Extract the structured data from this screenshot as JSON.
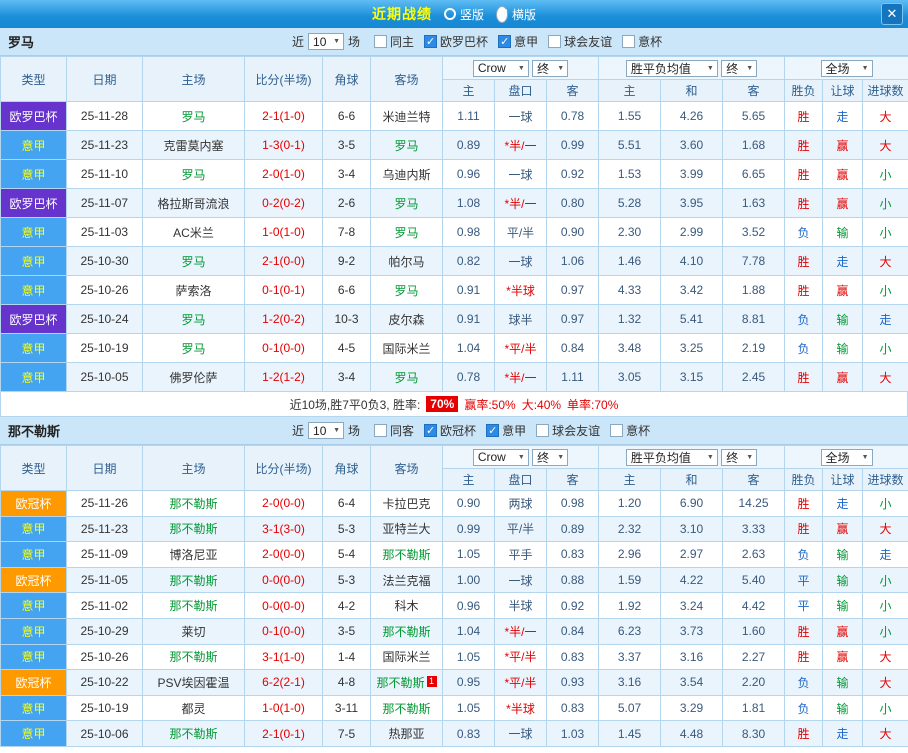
{
  "titlebar": {
    "title": "近期战绩",
    "radios": [
      {
        "label": "竖版",
        "selected": false
      },
      {
        "label": "横版",
        "selected": true
      }
    ],
    "close": "✕"
  },
  "controls": {
    "near": "近",
    "games": "10",
    "games_suffix": "场",
    "company": "Crow",
    "period1": "终",
    "avg": "胜平负均值",
    "period2": "终",
    "scope": "全场"
  },
  "columns": [
    "类型",
    "日期",
    "主场",
    "比分(半场)",
    "角球",
    "客场",
    "主",
    "盘口",
    "客",
    "主",
    "和",
    "客",
    "胜负",
    "让球",
    "进球数"
  ],
  "sections": [
    {
      "team": "罗马",
      "filters": [
        {
          "label": "同主",
          "checked": false
        },
        {
          "label": "欧罗巴杯",
          "checked": true
        },
        {
          "label": "意甲",
          "checked": true
        },
        {
          "label": "球会友谊",
          "checked": false
        },
        {
          "label": "意杯",
          "checked": false
        }
      ],
      "rows": [
        {
          "league": "欧罗巴杯",
          "league_style": "europa",
          "date": "25-11-28",
          "home": "罗马",
          "home_focus": true,
          "score": "2-1(1-0)",
          "corners": "6-6",
          "away": "米迪兰特",
          "away_focus": false,
          "odds_home": "1.11",
          "handicap": "一球",
          "odds_away": "0.78",
          "win": "1.55",
          "draw": "4.26",
          "lose": "5.65",
          "result": "胜",
          "result_color": "red",
          "hresult": "走",
          "hresult_color": "blue",
          "goals": "大",
          "goals_color": "red"
        },
        {
          "league": "意甲",
          "league_style": "seriea",
          "date": "25-11-23",
          "home": "克雷莫内塞",
          "home_focus": false,
          "score": "1-3(0-1)",
          "corners": "3-5",
          "away": "罗马",
          "away_focus": true,
          "odds_home": "0.89",
          "handicap": "*半/一",
          "odds_away": "0.99",
          "win": "5.51",
          "draw": "3.60",
          "lose": "1.68",
          "result": "胜",
          "result_color": "red",
          "hresult": "赢",
          "hresult_color": "red",
          "goals": "大",
          "goals_color": "red"
        },
        {
          "league": "意甲",
          "league_style": "seriea",
          "date": "25-11-10",
          "home": "罗马",
          "home_focus": true,
          "score": "2-0(1-0)",
          "corners": "3-4",
          "away": "乌迪内斯",
          "away_focus": false,
          "odds_home": "0.96",
          "handicap": "一球",
          "odds_away": "0.92",
          "win": "1.53",
          "draw": "3.99",
          "lose": "6.65",
          "result": "胜",
          "result_color": "red",
          "hresult": "赢",
          "hresult_color": "red",
          "goals": "小",
          "goals_color": "green"
        },
        {
          "league": "欧罗巴杯",
          "league_style": "europa",
          "date": "25-11-07",
          "home": "格拉斯哥流浪",
          "home_focus": false,
          "score": "0-2(0-2)",
          "corners": "2-6",
          "away": "罗马",
          "away_focus": true,
          "odds_home": "1.08",
          "handicap": "*半/一",
          "odds_away": "0.80",
          "win": "5.28",
          "draw": "3.95",
          "lose": "1.63",
          "result": "胜",
          "result_color": "red",
          "hresult": "赢",
          "hresult_color": "red",
          "goals": "小",
          "goals_color": "green"
        },
        {
          "league": "意甲",
          "league_style": "seriea",
          "date": "25-11-03",
          "home": "AC米兰",
          "home_focus": false,
          "score": "1-0(1-0)",
          "corners": "7-8",
          "away": "罗马",
          "away_focus": true,
          "odds_home": "0.98",
          "handicap": "平/半",
          "odds_away": "0.90",
          "win": "2.30",
          "draw": "2.99",
          "lose": "3.52",
          "result": "负",
          "result_color": "blue",
          "hresult": "输",
          "hresult_color": "green",
          "goals": "小",
          "goals_color": "green"
        },
        {
          "league": "意甲",
          "league_style": "seriea",
          "date": "25-10-30",
          "home": "罗马",
          "home_focus": true,
          "score": "2-1(0-0)",
          "corners": "9-2",
          "away": "帕尔马",
          "away_focus": false,
          "odds_home": "0.82",
          "handicap": "一球",
          "odds_away": "1.06",
          "win": "1.46",
          "draw": "4.10",
          "lose": "7.78",
          "result": "胜",
          "result_color": "red",
          "hresult": "走",
          "hresult_color": "blue",
          "goals": "大",
          "goals_color": "red"
        },
        {
          "league": "意甲",
          "league_style": "seriea",
          "date": "25-10-26",
          "home": "萨索洛",
          "home_focus": false,
          "score": "0-1(0-1)",
          "corners": "6-6",
          "away": "罗马",
          "away_focus": true,
          "odds_home": "0.91",
          "handicap": "*半球",
          "odds_away": "0.97",
          "win": "4.33",
          "draw": "3.42",
          "lose": "1.88",
          "result": "胜",
          "result_color": "red",
          "hresult": "赢",
          "hresult_color": "red",
          "goals": "小",
          "goals_color": "green"
        },
        {
          "league": "欧罗巴杯",
          "league_style": "europa",
          "date": "25-10-24",
          "home": "罗马",
          "home_focus": true,
          "score": "1-2(0-2)",
          "corners": "10-3",
          "away": "皮尔森",
          "away_focus": false,
          "odds_home": "0.91",
          "handicap": "球半",
          "odds_away": "0.97",
          "win": "1.32",
          "draw": "5.41",
          "lose": "8.81",
          "result": "负",
          "result_color": "blue",
          "hresult": "输",
          "hresult_color": "green",
          "goals": "走",
          "goals_color": "blue"
        },
        {
          "league": "意甲",
          "league_style": "seriea",
          "date": "25-10-19",
          "home": "罗马",
          "home_focus": true,
          "score": "0-1(0-0)",
          "corners": "4-5",
          "away": "国际米兰",
          "away_focus": false,
          "odds_home": "1.04",
          "handicap": "*平/半",
          "odds_away": "0.84",
          "win": "3.48",
          "draw": "3.25",
          "lose": "2.19",
          "result": "负",
          "result_color": "blue",
          "hresult": "输",
          "hresult_color": "green",
          "goals": "小",
          "goals_color": "green"
        },
        {
          "league": "意甲",
          "league_style": "seriea",
          "date": "25-10-05",
          "home": "佛罗伦萨",
          "home_focus": false,
          "score": "1-2(1-2)",
          "corners": "3-4",
          "away": "罗马",
          "away_focus": true,
          "odds_home": "0.78",
          "handicap": "*半/一",
          "odds_away": "1.11",
          "win": "3.05",
          "draw": "3.15",
          "lose": "2.45",
          "result": "胜",
          "result_color": "red",
          "hresult": "赢",
          "hresult_color": "red",
          "goals": "大",
          "goals_color": "red"
        }
      ],
      "summary": {
        "prefix": "近10场,胜7平0负3, 胜率:",
        "rate": "70%",
        "part1": "赢率:50%",
        "part2": "大:40%",
        "part3": "单率:70%"
      }
    },
    {
      "team": "那不勒斯",
      "filters": [
        {
          "label": "同客",
          "checked": false
        },
        {
          "label": "欧冠杯",
          "checked": true
        },
        {
          "label": "意甲",
          "checked": true
        },
        {
          "label": "球会友谊",
          "checked": false
        },
        {
          "label": "意杯",
          "checked": false
        }
      ],
      "rows": [
        {
          "league": "欧冠杯",
          "league_style": "ucl",
          "date": "25-11-26",
          "home": "那不勒斯",
          "home_focus": true,
          "score": "2-0(0-0)",
          "corners": "6-4",
          "away": "卡拉巴克",
          "away_focus": false,
          "odds_home": "0.90",
          "handicap": "两球",
          "odds_away": "0.98",
          "win": "1.20",
          "draw": "6.90",
          "lose": "14.25",
          "result": "胜",
          "result_color": "red",
          "hresult": "走",
          "hresult_color": "blue",
          "goals": "小",
          "goals_color": "green"
        },
        {
          "league": "意甲",
          "league_style": "seriea",
          "date": "25-11-23",
          "home": "那不勒斯",
          "home_focus": true,
          "score": "3-1(3-0)",
          "corners": "5-3",
          "away": "亚特兰大",
          "away_focus": false,
          "odds_home": "0.99",
          "handicap": "平/半",
          "odds_away": "0.89",
          "win": "2.32",
          "draw": "3.10",
          "lose": "3.33",
          "result": "胜",
          "result_color": "red",
          "hresult": "赢",
          "hresult_color": "red",
          "goals": "大",
          "goals_color": "red"
        },
        {
          "league": "意甲",
          "league_style": "seriea",
          "date": "25-11-09",
          "home": "博洛尼亚",
          "home_focus": false,
          "score": "2-0(0-0)",
          "corners": "5-4",
          "away": "那不勒斯",
          "away_focus": true,
          "odds_home": "1.05",
          "handicap": "平手",
          "odds_away": "0.83",
          "win": "2.96",
          "draw": "2.97",
          "lose": "2.63",
          "result": "负",
          "result_color": "blue",
          "hresult": "输",
          "hresult_color": "green",
          "goals": "走",
          "goals_color": "blue"
        },
        {
          "league": "欧冠杯",
          "league_style": "ucl",
          "date": "25-11-05",
          "home": "那不勒斯",
          "home_focus": true,
          "score": "0-0(0-0)",
          "corners": "5-3",
          "away": "法兰克福",
          "away_focus": false,
          "odds_home": "1.00",
          "handicap": "一球",
          "odds_away": "0.88",
          "win": "1.59",
          "draw": "4.22",
          "lose": "5.40",
          "result": "平",
          "result_color": "blue",
          "hresult": "输",
          "hresult_color": "green",
          "goals": "小",
          "goals_color": "green"
        },
        {
          "league": "意甲",
          "league_style": "seriea",
          "date": "25-11-02",
          "home": "那不勒斯",
          "home_focus": true,
          "score": "0-0(0-0)",
          "corners": "4-2",
          "away": "科木",
          "away_focus": false,
          "odds_home": "0.96",
          "handicap": "半球",
          "odds_away": "0.92",
          "win": "1.92",
          "draw": "3.24",
          "lose": "4.42",
          "result": "平",
          "result_color": "blue",
          "hresult": "输",
          "hresult_color": "green",
          "goals": "小",
          "goals_color": "green"
        },
        {
          "league": "意甲",
          "league_style": "seriea",
          "date": "25-10-29",
          "home": "莱切",
          "home_focus": false,
          "score": "0-1(0-0)",
          "corners": "3-5",
          "away": "那不勒斯",
          "away_focus": true,
          "odds_home": "1.04",
          "handicap": "*半/一",
          "odds_away": "0.84",
          "win": "6.23",
          "draw": "3.73",
          "lose": "1.60",
          "result": "胜",
          "result_color": "red",
          "hresult": "赢",
          "hresult_color": "red",
          "goals": "小",
          "goals_color": "green"
        },
        {
          "league": "意甲",
          "league_style": "seriea",
          "date": "25-10-26",
          "home": "那不勒斯",
          "home_focus": true,
          "score": "3-1(1-0)",
          "corners": "1-4",
          "away": "国际米兰",
          "away_focus": false,
          "odds_home": "1.05",
          "handicap": "*平/半",
          "odds_away": "0.83",
          "win": "3.37",
          "draw": "3.16",
          "lose": "2.27",
          "result": "胜",
          "result_color": "red",
          "hresult": "赢",
          "hresult_color": "red",
          "goals": "大",
          "goals_color": "red"
        },
        {
          "league": "欧冠杯",
          "league_style": "ucl",
          "date": "25-10-22",
          "home": "PSV埃因霍温",
          "home_focus": false,
          "score": "6-2(2-1)",
          "corners": "4-8",
          "away": "那不勒斯",
          "away_focus": true,
          "away_badge": "1",
          "odds_home": "0.95",
          "handicap": "*平/半",
          "odds_away": "0.93",
          "win": "3.16",
          "draw": "3.54",
          "lose": "2.20",
          "result": "负",
          "result_color": "blue",
          "hresult": "输",
          "hresult_color": "green",
          "goals": "大",
          "goals_color": "red"
        },
        {
          "league": "意甲",
          "league_style": "seriea",
          "date": "25-10-19",
          "home": "都灵",
          "home_focus": false,
          "score": "1-0(1-0)",
          "corners": "3-11",
          "away": "那不勒斯",
          "away_focus": true,
          "odds_home": "1.05",
          "handicap": "*半球",
          "odds_away": "0.83",
          "win": "5.07",
          "draw": "3.29",
          "lose": "1.81",
          "result": "负",
          "result_color": "blue",
          "hresult": "输",
          "hresult_color": "green",
          "goals": "小",
          "goals_color": "green"
        },
        {
          "league": "意甲",
          "league_style": "seriea",
          "date": "25-10-06",
          "home": "那不勒斯",
          "home_focus": true,
          "score": "2-1(0-1)",
          "corners": "7-5",
          "away": "热那亚",
          "away_focus": false,
          "odds_home": "0.83",
          "handicap": "一球",
          "odds_away": "1.03",
          "win": "1.45",
          "draw": "4.48",
          "lose": "8.30",
          "result": "胜",
          "result_color": "red",
          "hresult": "走",
          "hresult_color": "blue",
          "goals": "大",
          "goals_color": "red"
        }
      ]
    }
  ]
}
